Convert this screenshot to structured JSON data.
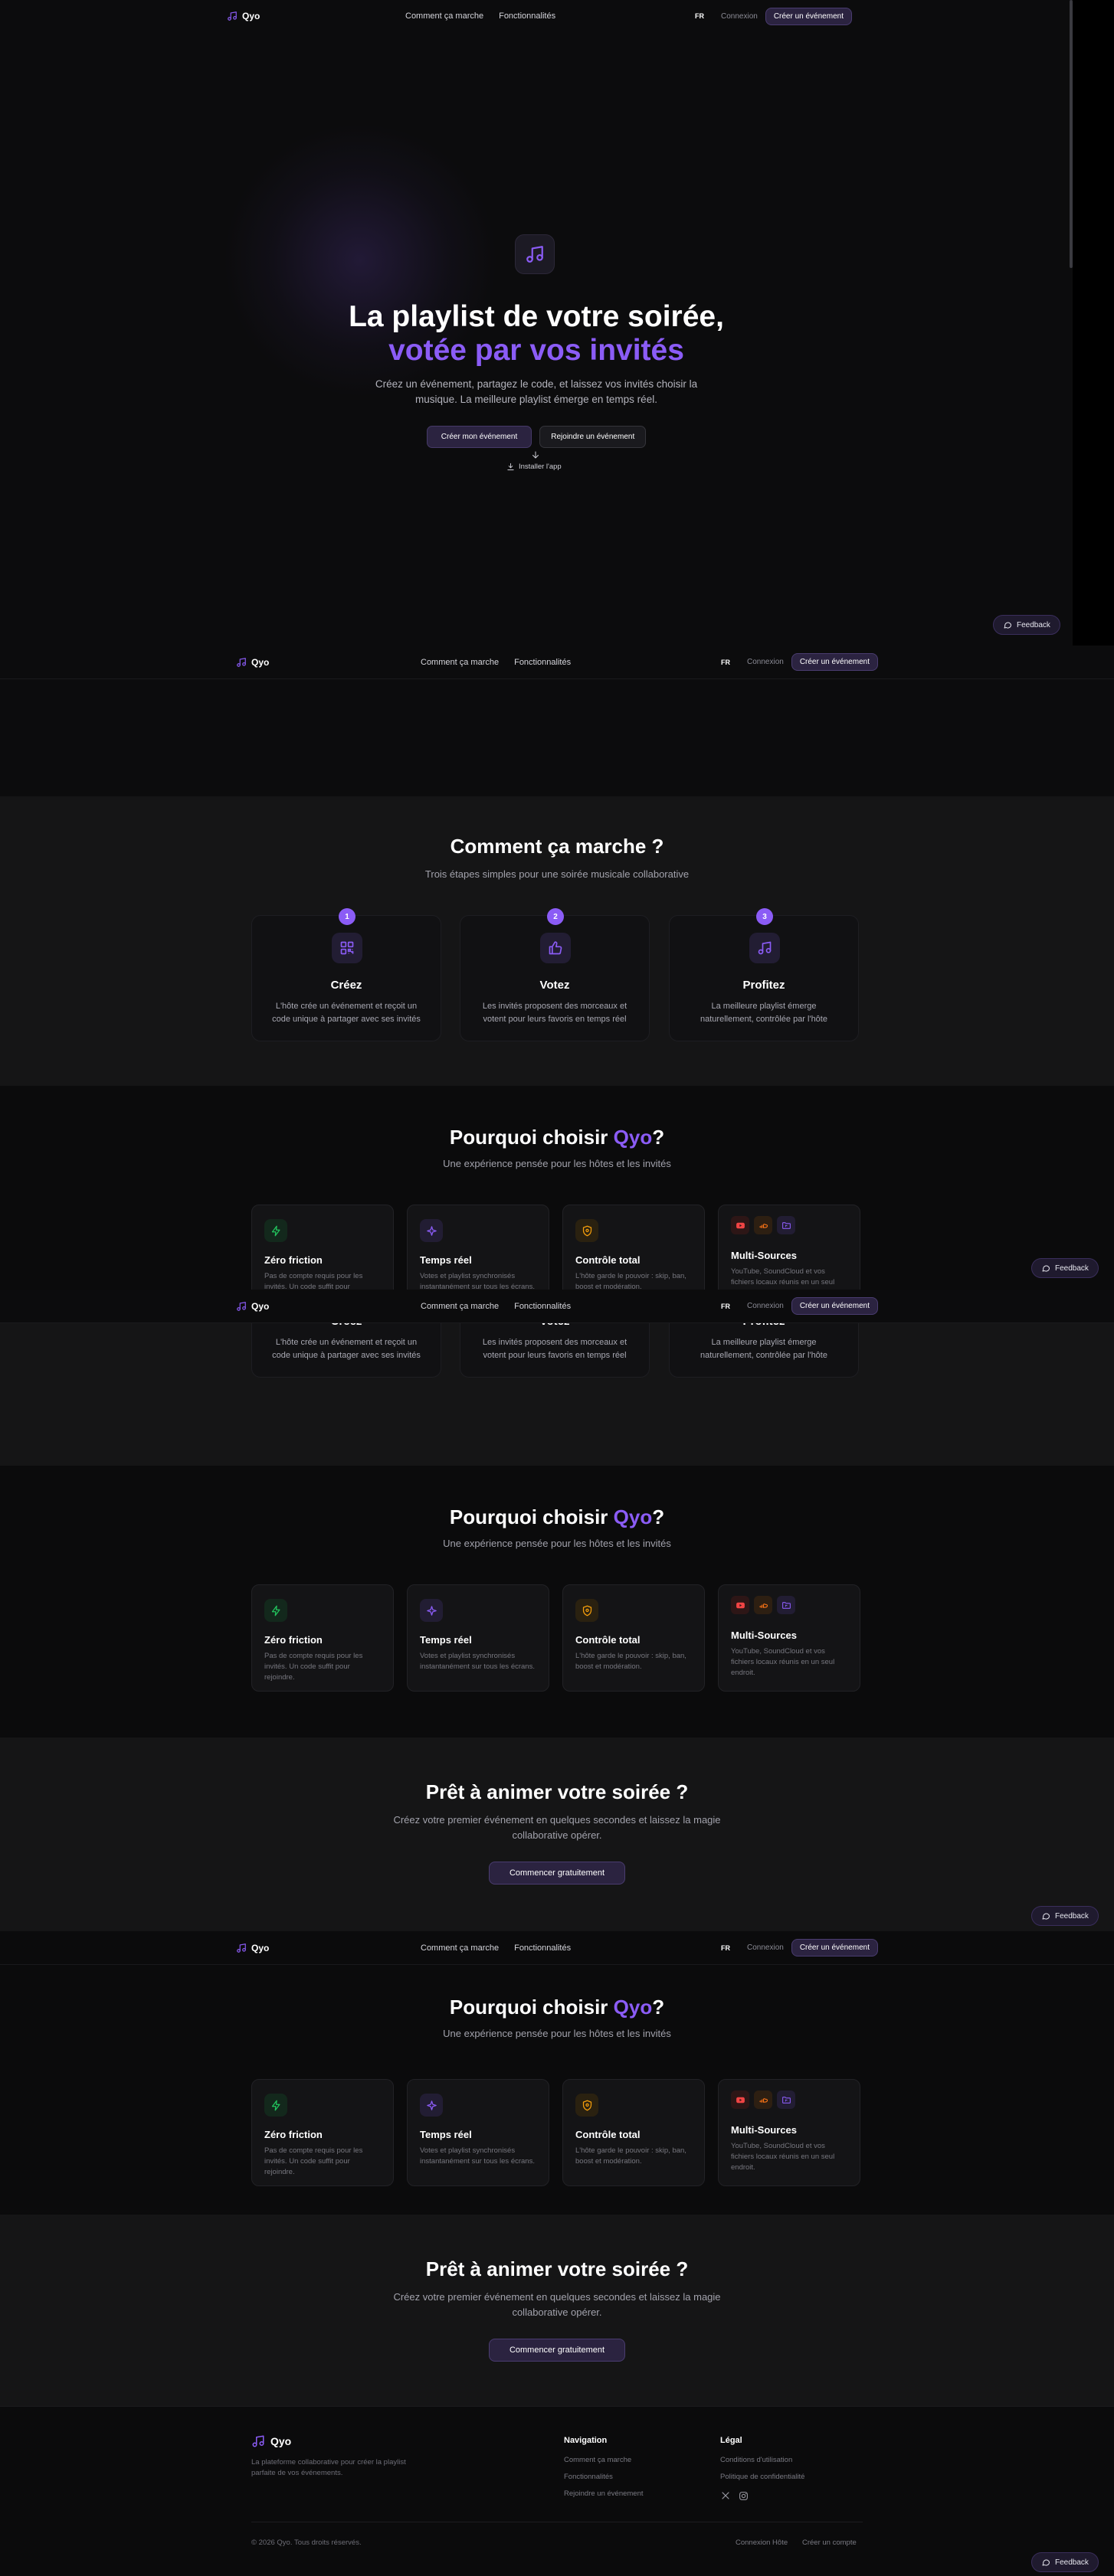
{
  "brand": {
    "name": "Qyo",
    "accent": "#8b5cf6"
  },
  "nav": {
    "how": "Comment ça marche",
    "features": "Fonctionnalités",
    "lang": "FR",
    "login": "Connexion",
    "cta": "Créer un événement"
  },
  "hero": {
    "title_line1": "La playlist de votre soirée,",
    "title_line2": "votée par vos invités",
    "subtitle_line1": "Créez un événement, partagez le code, et laissez vos invités choisir la",
    "subtitle_line2": "musique. La meilleure playlist émerge en temps réel.",
    "create_button": "Créer mon événement",
    "join_button": "Rejoindre un événement",
    "install": "Installer l'app"
  },
  "how": {
    "title": "Comment ça marche ?",
    "subtitle": "Trois étapes simples pour une soirée musicale collaborative",
    "steps": [
      {
        "num": "1",
        "icon": "qr-code-icon",
        "title": "Créez",
        "desc": "L'hôte crée un événement et reçoit un code unique à partager avec ses invités"
      },
      {
        "num": "2",
        "icon": "thumbs-up-icon",
        "title": "Votez",
        "desc": "Les invités proposent des morceaux et votent pour leurs favoris en temps réel"
      },
      {
        "num": "3",
        "icon": "music-note-icon",
        "title": "Profitez",
        "desc": "La meilleure playlist émerge naturellement, contrôlée par l'hôte"
      }
    ]
  },
  "why": {
    "title_prefix": "Pourquoi choisir ",
    "title_brand": "Qyo",
    "title_suffix": "?",
    "subtitle": "Une expérience pensée pour les hôtes et les invités",
    "features": [
      {
        "title": "Zéro friction",
        "desc": "Pas de compte requis pour les invités. Un code suffit pour rejoindre.",
        "icon": "lightning-icon",
        "color": "#22c55e"
      },
      {
        "title": "Temps réel",
        "desc": "Votes et playlist synchronisés instantanément sur tous les écrans.",
        "icon": "sparkle-icon",
        "color": "#8b5cf6"
      },
      {
        "title": "Contrôle total",
        "desc": "L'hôte garde le pouvoir : skip, ban, boost et modération.",
        "icon": "shield-icon",
        "color": "#f59e0b"
      },
      {
        "title": "Multi-Sources",
        "desc": "YouTube, SoundCloud et vos fichiers locaux réunis en un seul endroit.",
        "icon": "sources-icons",
        "color": "#ef4444"
      }
    ]
  },
  "ready": {
    "title": "Prêt à animer votre soirée ?",
    "subtitle_line1": "Créez votre premier événement en quelques secondes et laissez la magie",
    "subtitle_line2": "collaborative opérer.",
    "button": "Commencer gratuitement"
  },
  "footer": {
    "tagline_line1": "La plateforme collaborative pour créer la playlist",
    "tagline_line2": "parfaite de vos événements.",
    "nav_title": "Navigation",
    "nav_links": [
      "Comment ça marche",
      "Fonctionnalités",
      "Rejoindre un événement"
    ],
    "legal_title": "Légal",
    "legal_links": [
      "Conditions d'utilisation",
      "Politique de confidentialité"
    ],
    "copyright": "© 2026 Qyo. Tous droits réservés.",
    "host_login": "Connexion Hôte",
    "create_account": "Créer un compte"
  },
  "feedback": "Feedback"
}
